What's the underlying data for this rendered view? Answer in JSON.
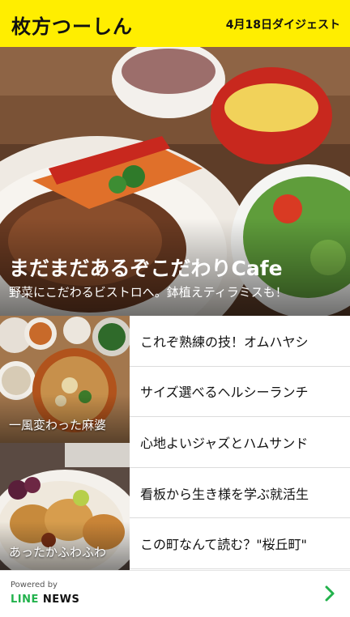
{
  "header": {
    "logo": "枚方つーしん",
    "date_label": "4月18日ダイジェスト"
  },
  "hero": {
    "title": "まだまだあるぞこだわりCafe",
    "subtitle": "野菜にこだわるビストロへ。鉢植えティラミスも！"
  },
  "thumbs": [
    {
      "caption": "一風変わった麻婆"
    },
    {
      "caption": "あったかふわふわ"
    }
  ],
  "articles": [
    {
      "title": "これぞ熟練の技！オムハヤシ"
    },
    {
      "title": "サイズ選べるヘルシーランチ"
    },
    {
      "title": "心地よいジャズとハムサンド"
    },
    {
      "title": "看板から生き様を学ぶ就活生"
    },
    {
      "title": "この町なんて読む？\"桜丘町\""
    }
  ],
  "footer": {
    "powered_by": "Powered by",
    "brand_line": "LINE",
    "brand_news": " NEWS",
    "arrow_icon": "chevron-right-icon"
  },
  "colors": {
    "header_bg": "#ffee00",
    "line_green": "#22b24c"
  }
}
